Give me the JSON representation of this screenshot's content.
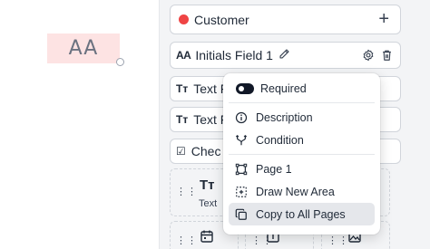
{
  "canvas": {
    "initials_text": "AA",
    "initials_fill": "#fde3e3"
  },
  "panel": {
    "submitter": {
      "name": "Customer",
      "color": "#ef4444",
      "add_icon": "plus-icon"
    },
    "selected_field": {
      "type_icon_text": "AA",
      "label": "Initials Field 1",
      "edit_icon": "pencil-icon",
      "settings_icon": "gear-icon",
      "delete_icon": "trash-icon"
    },
    "field_rows": [
      {
        "icon": "text-type-icon",
        "icon_text": "Tт",
        "label": "Text F"
      },
      {
        "icon": "text-type-icon",
        "icon_text": "Tт",
        "label": "Text F"
      },
      {
        "icon": "checkbox-icon",
        "icon_text": "☑",
        "label": "Chec"
      }
    ],
    "field_tiles": [
      {
        "icon": "text-type-icon",
        "icon_text": "Tт",
        "label": "Text"
      }
    ]
  },
  "context_menu": {
    "items": [
      {
        "name": "required",
        "icon": "toggle-on-icon",
        "label": "Required"
      },
      {
        "name": "description",
        "icon": "info-circle-icon",
        "label": "Description"
      },
      {
        "name": "condition",
        "icon": "branch-icon",
        "label": "Condition"
      },
      {
        "name": "page",
        "icon": "frame-icon",
        "label": "Page 1"
      },
      {
        "name": "draw-new-area",
        "icon": "dashed-plus-square-icon",
        "label": "Draw New Area"
      },
      {
        "name": "copy-to-all-pages",
        "icon": "copy-icon",
        "label": "Copy to All Pages"
      }
    ]
  }
}
